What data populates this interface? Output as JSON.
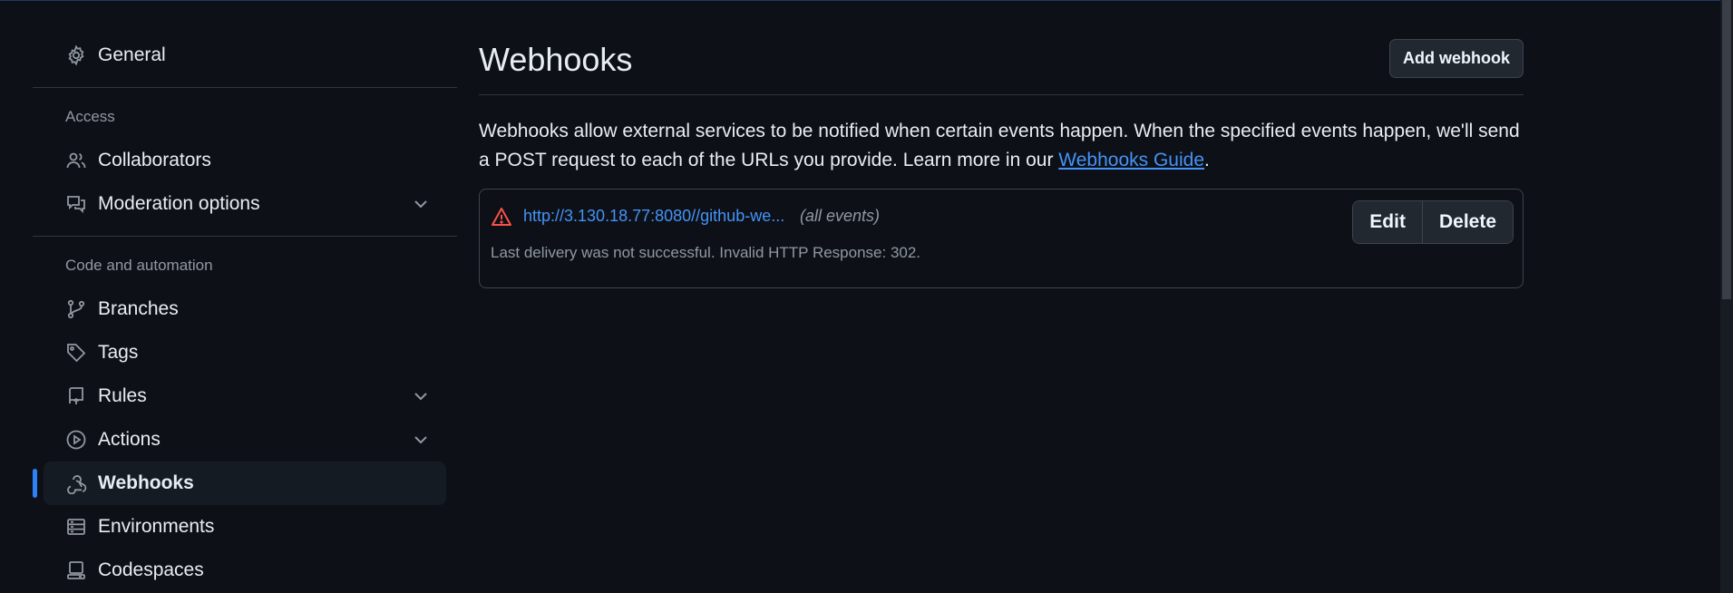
{
  "sidebar": {
    "general": {
      "label": "General",
      "icon": "gear-icon"
    },
    "access_label": "Access",
    "access_items": [
      {
        "label": "Collaborators",
        "icon": "people-icon"
      },
      {
        "label": "Moderation options",
        "icon": "comment-discussion-icon",
        "expandable": true
      }
    ],
    "code_label": "Code and automation",
    "code_items": [
      {
        "label": "Branches",
        "icon": "git-branch-icon"
      },
      {
        "label": "Tags",
        "icon": "tag-icon"
      },
      {
        "label": "Rules",
        "icon": "repo-push-icon",
        "expandable": true
      },
      {
        "label": "Actions",
        "icon": "play-icon",
        "expandable": true
      },
      {
        "label": "Webhooks",
        "icon": "webhook-icon",
        "active": true
      },
      {
        "label": "Environments",
        "icon": "server-icon"
      },
      {
        "label": "Codespaces",
        "icon": "codespaces-icon"
      }
    ]
  },
  "main": {
    "title": "Webhooks",
    "add_button": "Add webhook",
    "description_text": "Webhooks allow external services to be notified when certain events happen. When the specified events happen, we'll send a POST request to each of the URLs you provide. Learn more in our ",
    "description_link": "Webhooks Guide",
    "description_end": ".",
    "webhook": {
      "url": "http://3.130.18.77:8080//github-we...",
      "events": "(all events)",
      "status": "Last delivery was not successful. Invalid HTTP Response: 302.",
      "edit_label": "Edit",
      "delete_label": "Delete"
    }
  },
  "colors": {
    "background": "#0d1117",
    "accent": "#2f81f7",
    "link": "#4493f8",
    "error": "#f85149"
  }
}
